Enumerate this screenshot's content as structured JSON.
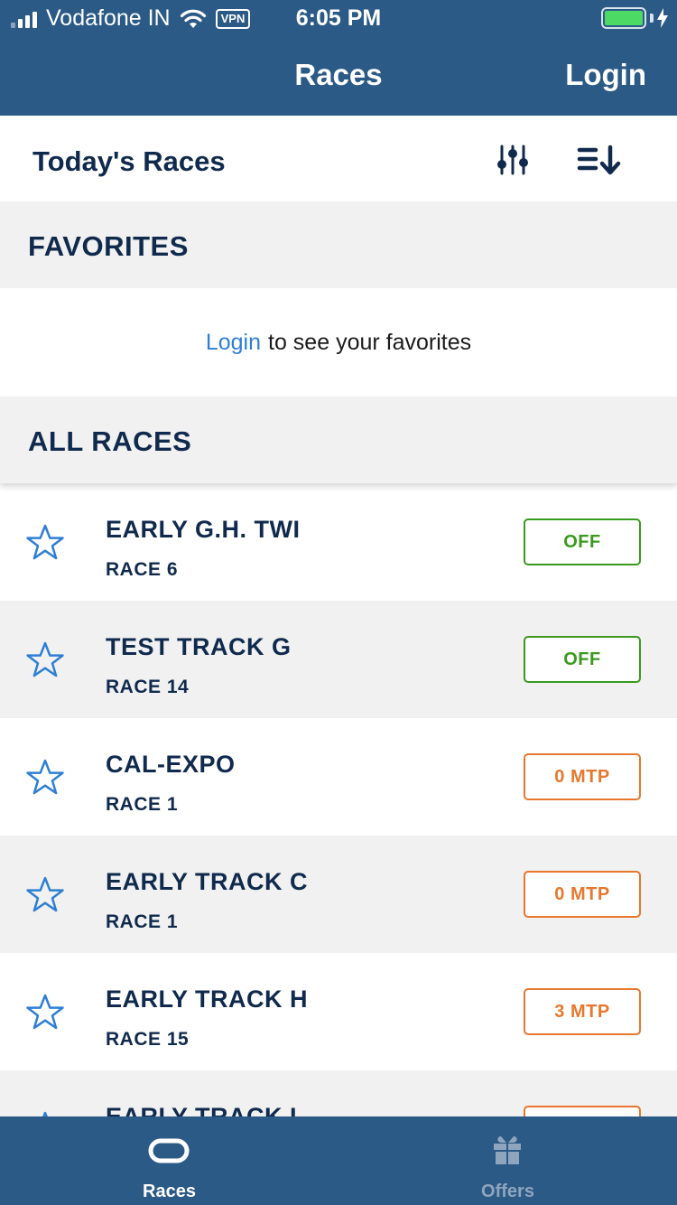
{
  "status_bar": {
    "carrier": "Vodafone IN",
    "vpn": "VPN",
    "time": "6:05 PM"
  },
  "nav": {
    "title": "Races",
    "login": "Login"
  },
  "toolbar": {
    "title": "Today's Races",
    "filter_icon": "sliders-icon",
    "sort_icon": "sort-icon"
  },
  "favorites": {
    "header": "FAVORITES",
    "login_link": "Login",
    "message": "to see your favorites"
  },
  "all_races": {
    "header": "ALL RACES",
    "items": [
      {
        "track": "EARLY G.H. TWI",
        "race": "RACE 6",
        "status": "OFF",
        "status_type": "off"
      },
      {
        "track": "TEST TRACK G",
        "race": "RACE 14",
        "status": "OFF",
        "status_type": "off"
      },
      {
        "track": "CAL-EXPO",
        "race": "RACE 1",
        "status": "0 MTP",
        "status_type": "mtp"
      },
      {
        "track": "EARLY TRACK C",
        "race": "RACE 1",
        "status": "0 MTP",
        "status_type": "mtp"
      },
      {
        "track": "EARLY TRACK H",
        "race": "RACE 15",
        "status": "3 MTP",
        "status_type": "mtp"
      },
      {
        "track": "EARLY TRACK I",
        "race": "",
        "status": "",
        "status_type": "mtp"
      }
    ]
  },
  "tabbar": {
    "tabs": [
      {
        "label": "Races",
        "icon": "track-icon",
        "active": true
      },
      {
        "label": "Offers",
        "icon": "gift-icon",
        "active": false
      }
    ]
  },
  "colors": {
    "brand_blue": "#2b5a86",
    "dark_navy": "#102a4d",
    "link_blue": "#2e7fd3",
    "status_off": "#3a9a1e",
    "status_mtp": "#e8772e"
  }
}
